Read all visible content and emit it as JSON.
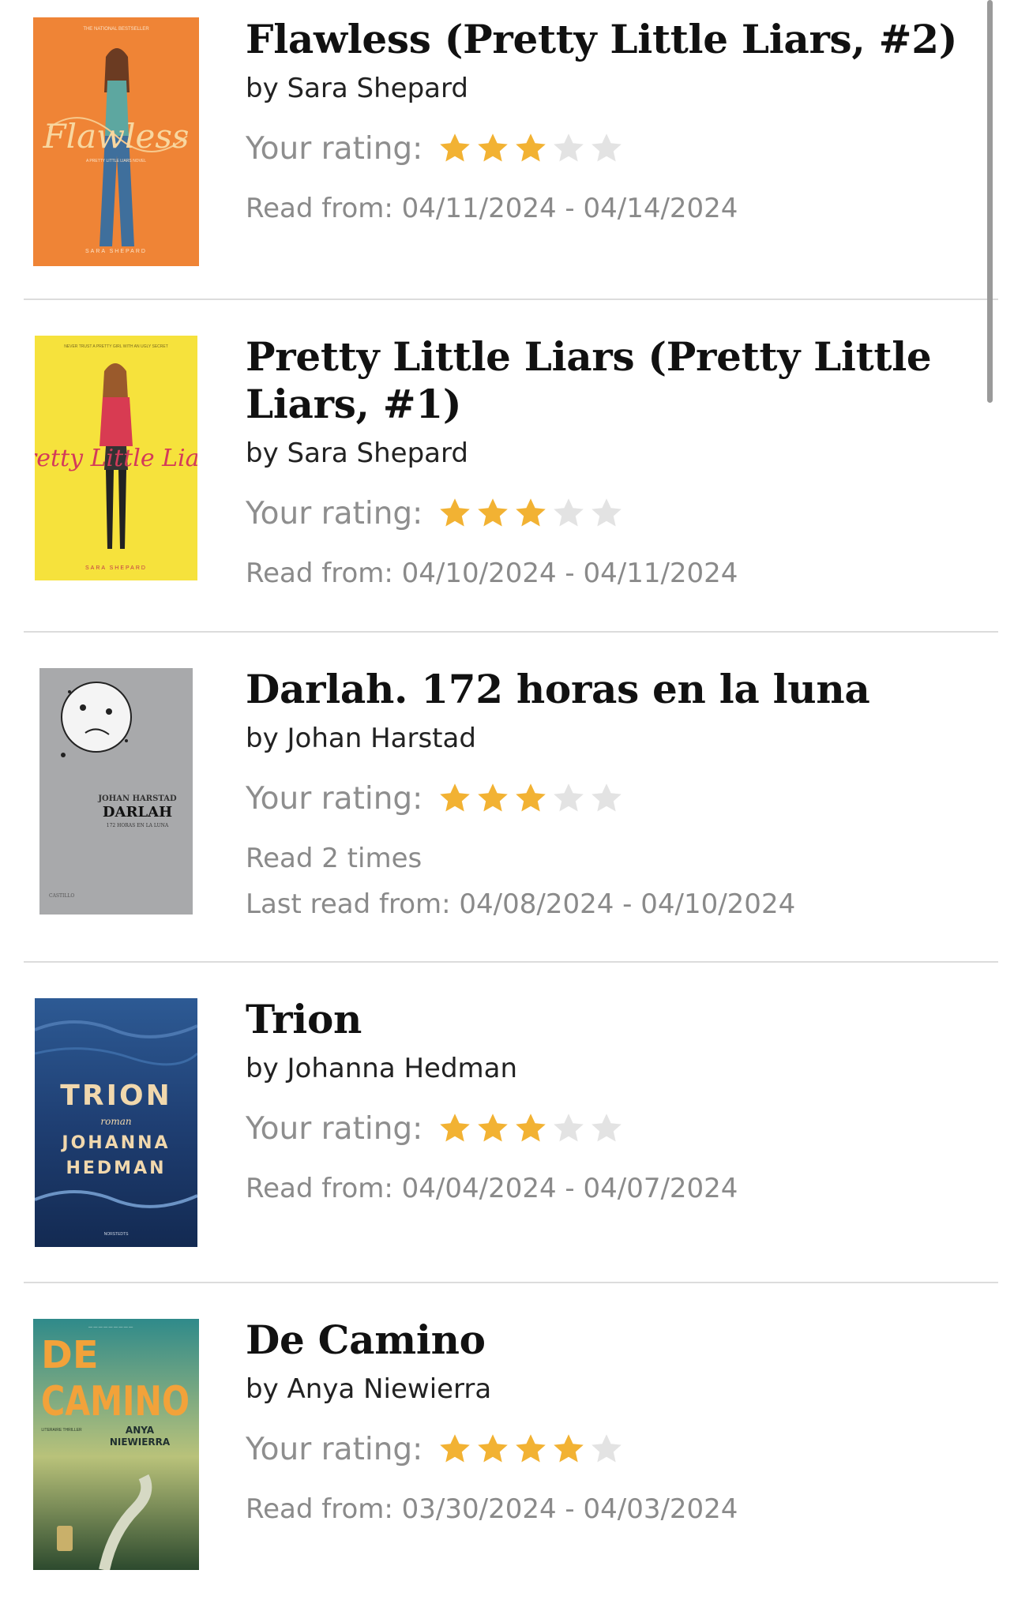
{
  "rating_label": "Your rating:",
  "colors": {
    "star_filled": "#f2b233",
    "star_empty": "#e3e3e3",
    "divider": "#dcdcdc"
  },
  "books": [
    {
      "title": "Flawless (Pretty Little Liars, #2)",
      "author": "by Sara Shepard",
      "rating": 3,
      "read_lines": [
        "Read from: 04/11/2024 - 04/14/2024"
      ],
      "cover": {
        "bg": "#ef8436",
        "top_text": "THE NATIONAL BESTSELLER",
        "script_title": "Flawless",
        "subtitle": "A PRETTY LITTLE LIARS NOVEL",
        "author_text": "SARA SHEPARD"
      }
    },
    {
      "title": "Pretty Little Liars (Pretty Little Liars, #1)",
      "author": "by Sara Shepard",
      "rating": 3,
      "read_lines": [
        "Read from: 04/10/2024 - 04/11/2024"
      ],
      "cover": {
        "bg": "#f6e23c",
        "top_text": "NEVER TRUST A PRETTY GIRL WITH AN UGLY SECRET",
        "script_title": "Pretty Little Liars",
        "author_text": "SARA SHEPARD"
      }
    },
    {
      "title": "Darlah. 172 horas en la luna",
      "author": "by Johan Harstad",
      "rating": 3,
      "read_lines": [
        "Read 2 times",
        "Last read from: 04/08/2024 - 04/10/2024"
      ],
      "cover": {
        "bg": "#a8a9ab",
        "author_text": "JOHAN HARSTAD",
        "title_text": "DARLAH",
        "subtitle": "172 HORAS EN LA LUNA",
        "publisher": "CASTILLO"
      }
    },
    {
      "title": "Trion",
      "author": "by Johanna Hedman",
      "rating": 3,
      "read_lines": [
        "Read from: 04/04/2024 - 04/07/2024"
      ],
      "cover": {
        "bg": "#1f3f73",
        "title_text": "TRION",
        "subtitle": "roman",
        "author_line1": "JOHANNA",
        "author_line2": "HEDMAN",
        "publisher": "NORSTEDTS"
      }
    },
    {
      "title": "De Camino",
      "author": "by Anya Niewierra",
      "rating": 4,
      "read_lines": [
        "Read from: 03/30/2024 - 04/03/2024"
      ],
      "cover": {
        "bg": "#2f8a8a",
        "title_line1": "DE",
        "title_line2": "CAMINO",
        "genre": "LITERAIRE THRILLER",
        "author_line1": "ANYA",
        "author_line2": "NIEWIERRA"
      }
    }
  ]
}
